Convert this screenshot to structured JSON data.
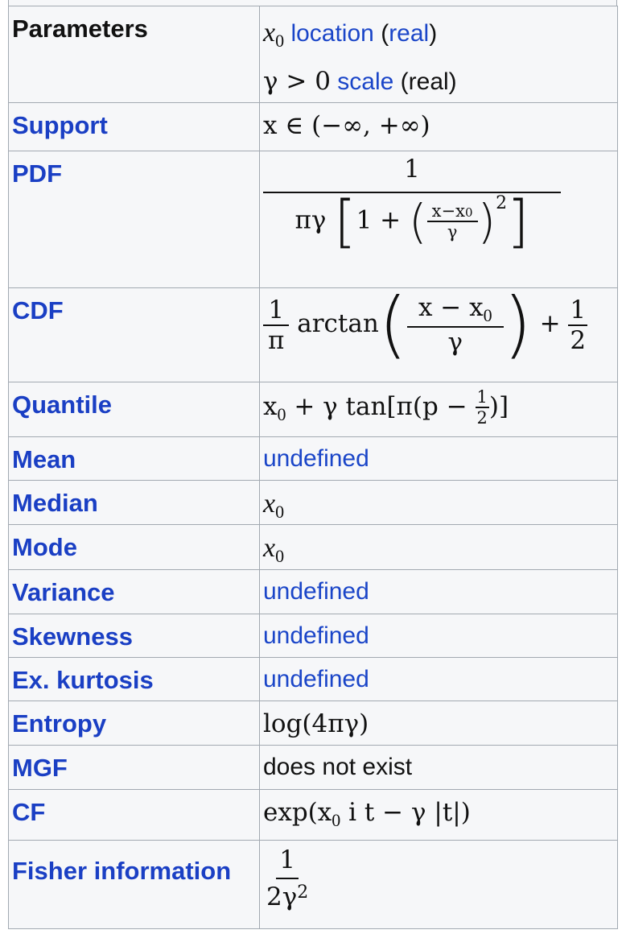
{
  "rows": [
    {
      "label": "Parameters",
      "line1": {
        "math": "x",
        "sub": "0",
        "word": "location",
        "paren_open": "(",
        "link": "real",
        "paren_close": ")"
      },
      "line2": {
        "math": "γ > 0",
        "word": "scale",
        "text": "(real)"
      }
    },
    {
      "label": "Support",
      "math": "x ∈ (−∞, +∞)"
    },
    {
      "label": "PDF",
      "numerator": "1",
      "denominator": {
        "prefix": "πγ",
        "open": "[",
        "one_plus": "1 +",
        "inner_num": "x−x",
        "inner_sub": "0",
        "inner_den": "γ",
        "exp": "2",
        "close": "]"
      }
    },
    {
      "label": "CDF",
      "frac1_num": "1",
      "frac1_den": "π",
      "func": "arctan",
      "inner_num": "x − x",
      "inner_sub": "0",
      "inner_den": "γ",
      "plus": "+",
      "frac2_num": "1",
      "frac2_den": "2"
    },
    {
      "label": "Quantile",
      "pre": "x",
      "sub": "0",
      "mid": " + γ tan[π(p − ",
      "half_num": "1",
      "half_den": "2",
      "post": ")]"
    },
    {
      "label": "Mean",
      "value": "undefined"
    },
    {
      "label": "Median",
      "math": "x",
      "sub": "0"
    },
    {
      "label": "Mode",
      "math": "x",
      "sub": "0"
    },
    {
      "label": "Variance",
      "value": "undefined"
    },
    {
      "label": "Skewness",
      "value": "undefined"
    },
    {
      "label": "Ex. kurtosis",
      "value": "undefined"
    },
    {
      "label": "Entropy",
      "math": "log(4πγ)"
    },
    {
      "label": "MGF",
      "value": "does not exist"
    },
    {
      "label": "CF",
      "pre": "exp(x",
      "sub": "0",
      "post": " i t − γ |t|)"
    },
    {
      "label": "Fisher information",
      "numerator": "1",
      "denominator": "2γ",
      "exp": "2"
    }
  ],
  "colors": {
    "link": "#1a45c8",
    "label": "#1a3fc4",
    "border": "#a2a9b1",
    "background": "#f6f7f9"
  }
}
